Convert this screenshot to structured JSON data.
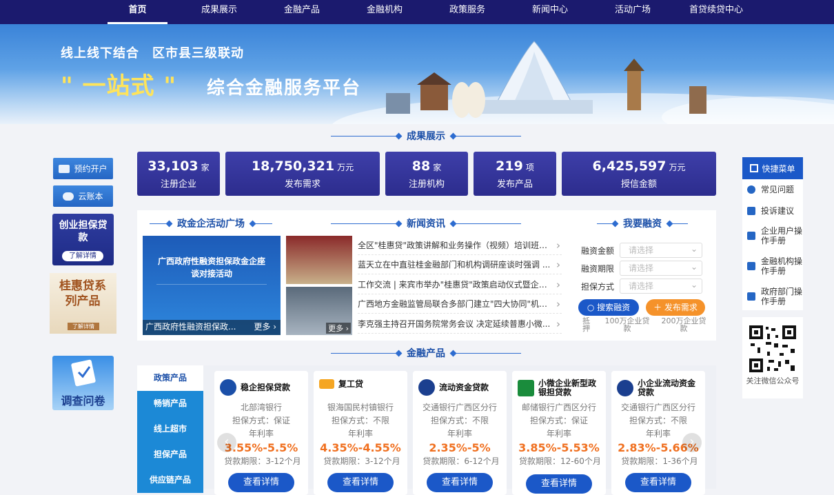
{
  "nav": {
    "items": [
      "首页",
      "成果展示",
      "金融产品",
      "金融机构",
      "政策服务",
      "新闻中心",
      "活动广场",
      "首贷续贷中心"
    ]
  },
  "banner": {
    "line1": "线上线下结合　区市县三级联动",
    "line2": "\" 一站式 \"",
    "line3": "综合金融服务平台"
  },
  "sections": {
    "results": "成果展示",
    "activity": "政金企活动广场",
    "news": "新闻资讯",
    "finance": "我要融资",
    "products": "金融产品"
  },
  "left": {
    "open_account": "预约开户",
    "cloud_book": "云账本",
    "promo1": {
      "title": "创业担保贷款",
      "more": "了解详情"
    },
    "promo2": {
      "title": "桂惠贷系列产品",
      "more": "了解详情"
    },
    "survey": "调查问卷"
  },
  "stats": [
    {
      "num": "33,103",
      "unit": "家",
      "label": "注册企业"
    },
    {
      "num": "18,750,321",
      "unit": "万元",
      "label": "发布需求"
    },
    {
      "num": "88",
      "unit": "家",
      "label": "注册机构"
    },
    {
      "num": "219",
      "unit": "项",
      "label": "发布产品"
    },
    {
      "num": "6,425,597",
      "unit": "万元",
      "label": "授信金额"
    }
  ],
  "activity": {
    "poster_title": "广西政府性融资担保政金企座谈对接活动",
    "caption": "广西政府性融资担保政...",
    "more": "更多",
    "thumb_more": "更多"
  },
  "news": [
    "全区\"桂惠贷\"政策讲解和业务操作（视频）培训班成功举办",
    "蓝天立在中直驻桂金融部门和机构调研座谈时强调 ...",
    "工作交流 | 来宾市举办\"桂惠贷\"政策启动仪式暨企业...",
    "广西地方金融监管局联合多部门建立\"四大协同\"机制...",
    "李克强主持召开国务院常务会议 决定延续普惠小微..."
  ],
  "finance": {
    "fields": [
      {
        "label": "融资金额",
        "placeholder": "请选择"
      },
      {
        "label": "融资期限",
        "placeholder": "请选择"
      },
      {
        "label": "担保方式",
        "placeholder": "请选择"
      }
    ],
    "search": "搜索融资",
    "publish": "发布需求",
    "tags": [
      "抵押",
      "100万企业贷款",
      "200万企业贷款"
    ]
  },
  "products": {
    "categories": [
      "政策产品",
      "畅销产品",
      "线上超市",
      "担保产品",
      "供应链产品"
    ],
    "cards": [
      {
        "name": "稳企担保贷款",
        "bank": "北部湾银行",
        "guarantee": "担保方式：保证",
        "rate_label": "年利率",
        "rate": "3.55%-5.5%",
        "term": "贷款期限：3-12个月",
        "btn": "查看详情",
        "color": "#1b4fa8"
      },
      {
        "name": "复工贷",
        "bank": "银海国民村镇银行",
        "guarantee": "担保方式：不限",
        "rate_label": "年利率",
        "rate": "4.35%-4.55%",
        "term": "贷款期限：3-12个月",
        "btn": "查看详情",
        "color": "#f5a623"
      },
      {
        "name": "流动资金贷款",
        "bank": "交通银行广西区分行",
        "guarantee": "担保方式：不限",
        "rate_label": "年利率",
        "rate": "2.35%-5%",
        "term": "贷款期限：6-12个月",
        "btn": "查看详情",
        "color": "#1b3f8f"
      },
      {
        "name": "小微企业新型政银担贷款",
        "bank": "邮储银行广西区分行",
        "guarantee": "担保方式：保证",
        "rate_label": "年利率",
        "rate": "3.85%-5.53%",
        "term": "贷款期限：12-60个月",
        "btn": "查看详情",
        "color": "#1a8c3c"
      },
      {
        "name": "小企业流动资金贷款",
        "bank": "交通银行广西区分行",
        "guarantee": "担保方式：不限",
        "rate_label": "年利率",
        "rate": "2.83%-5.66%",
        "term": "贷款期限：1-36个月",
        "btn": "查看详情",
        "color": "#1b3f8f"
      }
    ]
  },
  "right": {
    "menu_title": "快捷菜单",
    "items": [
      "常见问题",
      "投诉建议",
      "企业用户操作手册",
      "金融机构操作手册",
      "政府部门操作手册"
    ],
    "qr_caption": "关注微信公众号"
  }
}
